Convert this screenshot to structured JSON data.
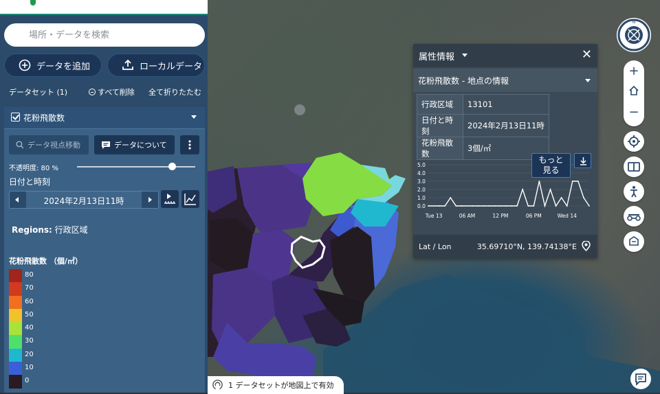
{
  "search": {
    "placeholder": "場所・データを検索"
  },
  "actions": {
    "add_data": "データを追加",
    "local_data": "ローカルデータ"
  },
  "datasets": {
    "count_label": "データセット (1)",
    "clear_all": "すべて削除",
    "collapse_all": "全て折りたたむ"
  },
  "dataset": {
    "title": "花粉飛散数",
    "move_to_data": "データ視点移動",
    "about": "データについて",
    "opacity_label": "不透明度: 80 %",
    "opacity": 0.8,
    "datetime_label": "日付と時刻",
    "datetime_value": "2024年2月13日11時",
    "regions_prefix": "Regions:",
    "regions_value": "行政区域",
    "legend_title": "花粉飛散数 （個/㎡）",
    "legend": [
      {
        "label": "80",
        "color": "#a1251a"
      },
      {
        "label": "70",
        "color": "#d13a1e"
      },
      {
        "label": "60",
        "color": "#f07020"
      },
      {
        "label": "50",
        "color": "#f2c22a"
      },
      {
        "label": "40",
        "color": "#a9e23b"
      },
      {
        "label": "30",
        "color": "#4fe06a"
      },
      {
        "label": "20",
        "color": "#1eb8cf"
      },
      {
        "label": "10",
        "color": "#3a5fd9"
      },
      {
        "label": "0",
        "color": "#2a1a24"
      }
    ]
  },
  "status": {
    "text": "1 データセットが地図上で有効"
  },
  "info": {
    "title": "属性情報",
    "subtitle": "花粉飛散数 - 地点の情報",
    "rows": [
      {
        "key": "行政区域",
        "value": "13101"
      },
      {
        "key": "日付と時刻",
        "value": "2024年2月13日11時"
      },
      {
        "key": "花粉飛散数",
        "value": "3個/㎡"
      }
    ],
    "more_label": "もっと見る",
    "more_line1": "もっと",
    "more_line2": "見る",
    "latlon_label": "Lat / Lon",
    "latlon_value": "35.69710°N, 139.74138°E"
  },
  "chart_data": {
    "type": "line",
    "y_ticks": [
      "5.0",
      "4.0",
      "3.0",
      "2.0",
      "1.0",
      "0.0"
    ],
    "x_ticks": [
      "Tue 13",
      "06 AM",
      "12 PM",
      "06 PM",
      "Wed 14"
    ],
    "ylim": [
      0,
      5
    ],
    "x_hours": [
      0,
      2,
      3,
      4,
      5,
      6,
      8,
      9,
      10,
      11,
      12,
      13,
      14,
      15,
      16,
      17,
      18,
      19,
      20,
      21,
      22,
      23,
      24,
      25,
      26,
      27,
      28,
      29
    ],
    "values": [
      0,
      0,
      0,
      1,
      0,
      0,
      0,
      0,
      0,
      0,
      0,
      0,
      0,
      0,
      0,
      2,
      0,
      0,
      3,
      0,
      2,
      0,
      1,
      0,
      3,
      3,
      1,
      0
    ]
  },
  "colors": {
    "sidebar": "#2c4b6a",
    "panel": "#3b6185",
    "accent": "#1c3557",
    "info_bg": "#3c4a57"
  }
}
